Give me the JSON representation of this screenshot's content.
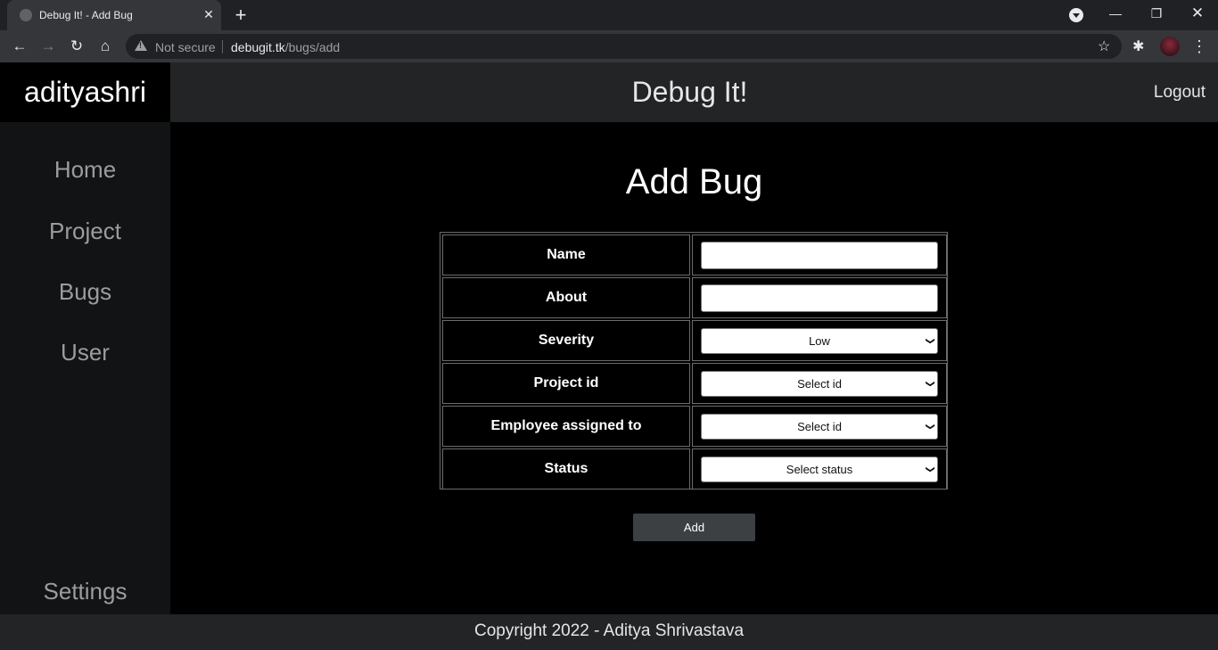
{
  "browser": {
    "tab_title": "Debug It! - Add Bug",
    "tab_close": "✕",
    "new_tab": "+",
    "not_secure": "Not secure",
    "url_host": "debugit.tk",
    "url_path": "/bugs/add",
    "icons": [
      "back-icon",
      "forward-icon",
      "reload-icon",
      "home-icon",
      "warning-icon",
      "star-icon",
      "extensions-icon",
      "avatar",
      "menu-icon"
    ]
  },
  "header": {
    "brand": "adityashri",
    "title": "Debug It!",
    "logout": "Logout"
  },
  "sidebar": {
    "items": [
      {
        "label": "Home"
      },
      {
        "label": "Project"
      },
      {
        "label": "Bugs"
      },
      {
        "label": "User"
      }
    ],
    "settings": "Settings"
  },
  "main": {
    "title": "Add Bug",
    "fields": [
      {
        "label": "Name",
        "type": "text",
        "value": ""
      },
      {
        "label": "About",
        "type": "text",
        "value": ""
      },
      {
        "label": "Severity",
        "type": "select",
        "value": "Low"
      },
      {
        "label": "Project id",
        "type": "select",
        "value": "Select id"
      },
      {
        "label": "Employee assigned to",
        "type": "select",
        "value": "Select id"
      },
      {
        "label": "Status",
        "type": "select",
        "value": "Select status"
      }
    ],
    "submit_label": "Add"
  },
  "footer": {
    "text": "Copyright 2022 - Aditya Shrivastava"
  },
  "colors": {
    "header_bg": "#222425",
    "sidebar_bg": "#111315",
    "page_bg": "#000000",
    "button_bg": "#3c4043"
  }
}
